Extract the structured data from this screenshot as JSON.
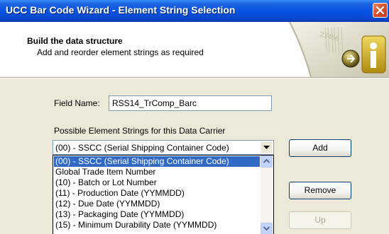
{
  "window": {
    "title": "UCC Bar Code Wizard - Element String Selection",
    "icons": {
      "close": "close-icon"
    }
  },
  "header": {
    "title": "Build the data structure",
    "subtitle": "Add and reorder element strings as required",
    "art_icon": "barcode-wizard-art",
    "art_text": "23456"
  },
  "form": {
    "field_name_label": "Field Name:",
    "field_name_value": "RSS14_TrComp_Barc",
    "possible_label": "Possible Element Strings for this Data Carrier",
    "combo_value": "(00) - SSCC (Serial Shipping Container Code)",
    "list_items": [
      "(00) - SSCC (Serial Shipping Container Code)",
      "Global Trade Item Number",
      "(10) - Batch or Lot Number",
      "(11) - Production Date (YYMMDD)",
      "(12) - Due Date (YYMMDD)",
      "(13) - Packaging Date (YYMMDD)",
      "(15) - Minimum Durability Date (YYMMDD)"
    ],
    "selected_index": 0
  },
  "buttons": {
    "add": "Add",
    "remove": "Remove",
    "up": "Up"
  },
  "colors": {
    "titlebar": "#0a54e4",
    "selection": "#316ac5",
    "dialog_bg": "#ece9d8"
  }
}
